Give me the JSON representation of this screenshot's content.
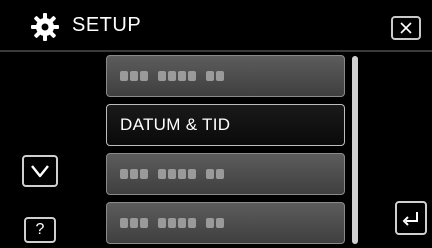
{
  "header": {
    "title": "SETUP",
    "icon": "gear-icon",
    "close_icon": "close-icon"
  },
  "menu": {
    "items": [
      {
        "label": "",
        "state": "dimmed"
      },
      {
        "label": "DATUM & TID",
        "state": "selected"
      },
      {
        "label": "",
        "state": "dimmed"
      },
      {
        "label": "",
        "state": "dimmed"
      }
    ]
  },
  "controls": {
    "down_icon": "chevron-down-icon",
    "help_label": "?",
    "back_icon": "return-icon"
  },
  "colors": {
    "background": "#000000",
    "item_face": "#4f4f4f",
    "item_border": "#8a8a8a",
    "text": "#ffffff"
  }
}
